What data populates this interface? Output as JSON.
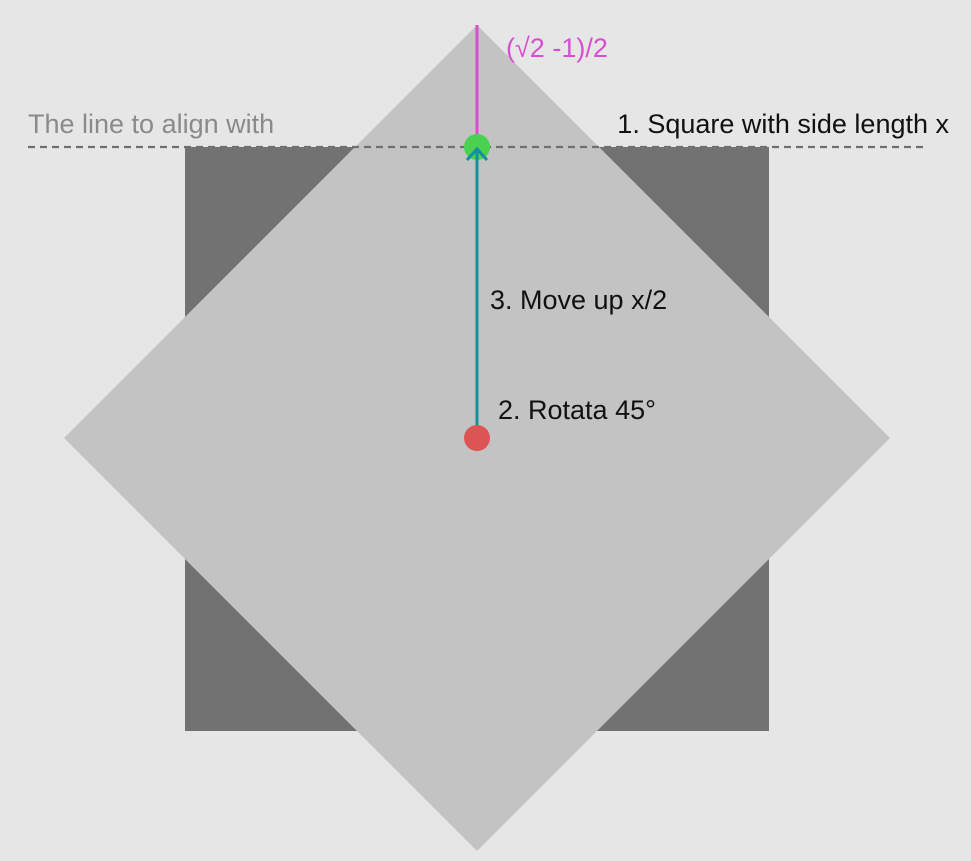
{
  "labels": {
    "align_line": "The line to align with",
    "square": "1. Square with side length x",
    "rotate": "2. Rotata 45°",
    "move_up": "3. Move up x/2",
    "offset": "(√2 -1)/2"
  },
  "colors": {
    "background": "#e6e6e6",
    "square": "#727272",
    "rotated_square": "#c3c3c3",
    "align_line": "#6f6f6f",
    "align_text": "#8a8a8a",
    "label_text": "#111111",
    "move_line": "#15909a",
    "offset_line": "#d64fd0",
    "center_dot": "#dc5454",
    "target_dot": "#4ad150"
  }
}
